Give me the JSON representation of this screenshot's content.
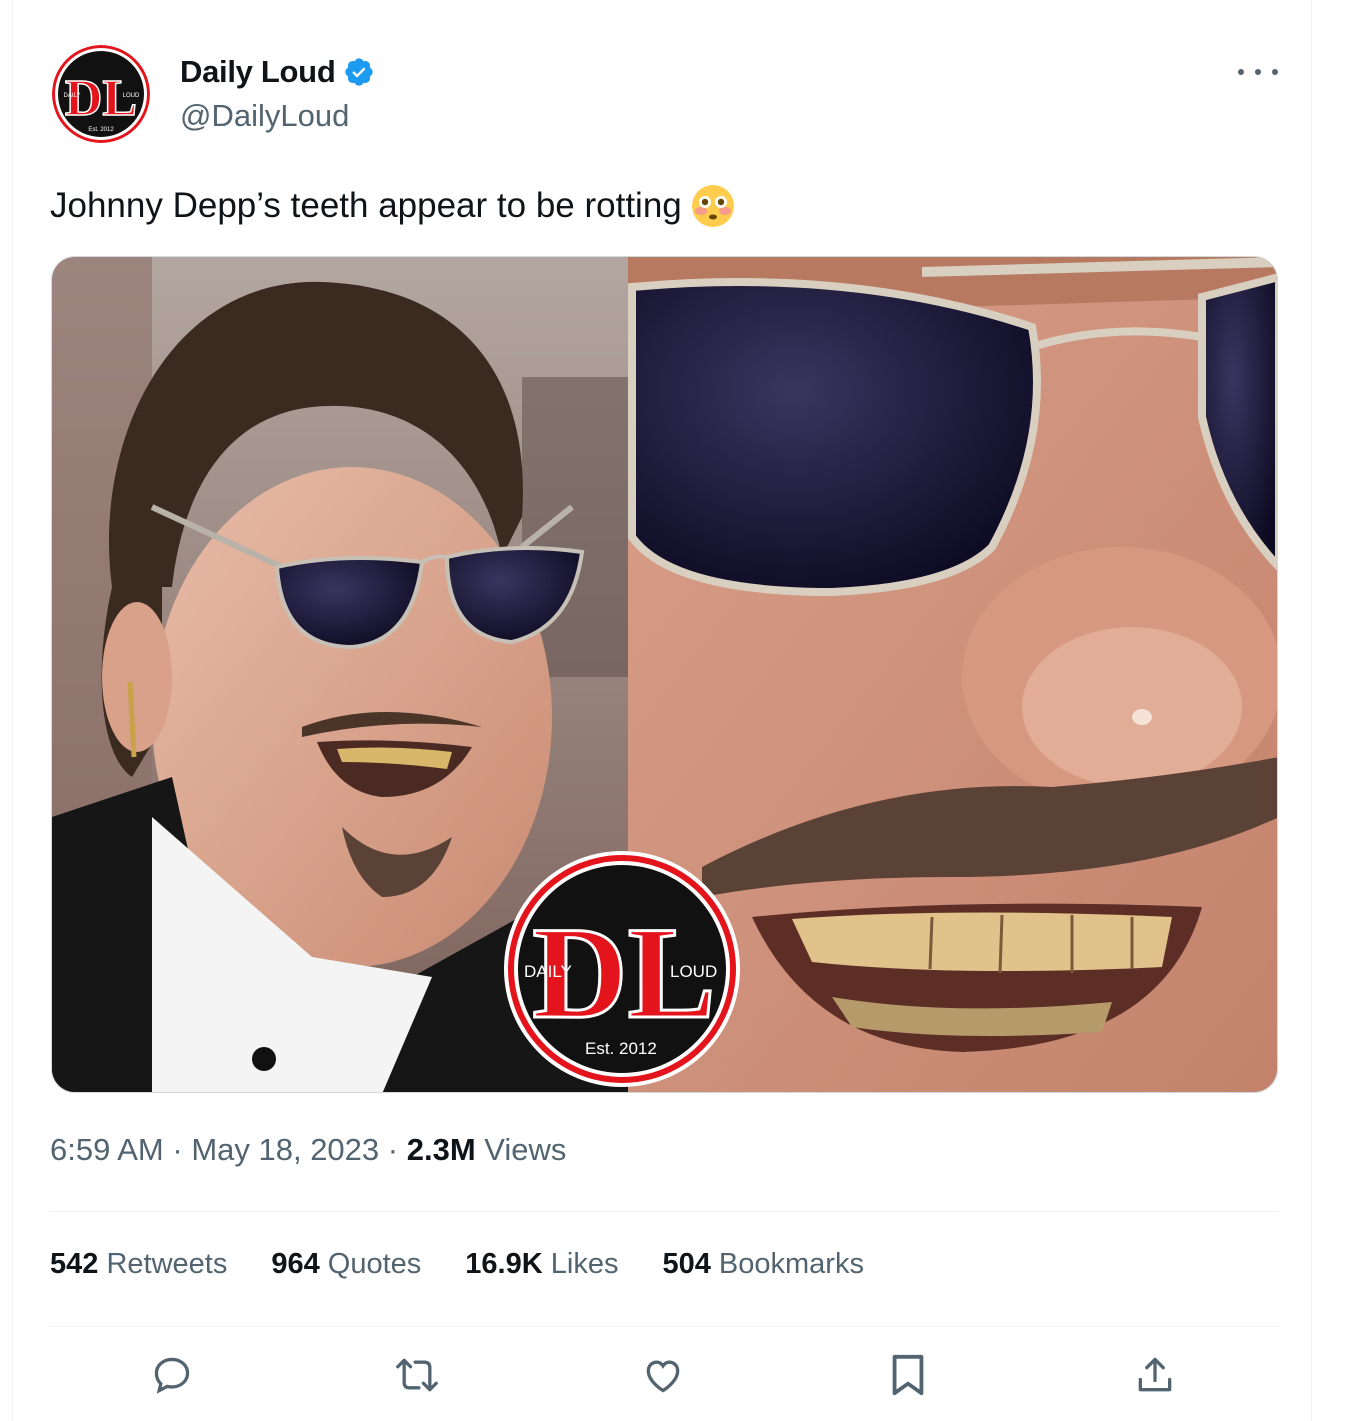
{
  "author": {
    "display_name": "Daily Loud",
    "handle": "@DailyLoud",
    "verified": true,
    "avatar_icon": "daily-loud-logo"
  },
  "tweet": {
    "text": "Johnny Depp’s teeth appear to be rotting",
    "emoji_icon": "flushed-face-emoji"
  },
  "media": {
    "watermark": {
      "left_word": "DAILY",
      "right_word": "LOUD",
      "est": "Est. 2012"
    }
  },
  "meta": {
    "time": "6:59 AM",
    "separator": " · ",
    "date": "May 18, 2023",
    "views_count": "2.3M",
    "views_label": " Views"
  },
  "stats": [
    {
      "count": "542",
      "label": " Retweets"
    },
    {
      "count": "964",
      "label": " Quotes"
    },
    {
      "count": "16.9K",
      "label": " Likes"
    },
    {
      "count": "504",
      "label": " Bookmarks"
    }
  ],
  "actions": [
    "reply-icon",
    "retweet-icon",
    "like-icon",
    "bookmark-icon",
    "share-icon"
  ],
  "colors": {
    "text": "#0f1419",
    "secondary": "#536471",
    "verified_blue": "#1d9bf0",
    "brand_red": "#e3141c"
  }
}
